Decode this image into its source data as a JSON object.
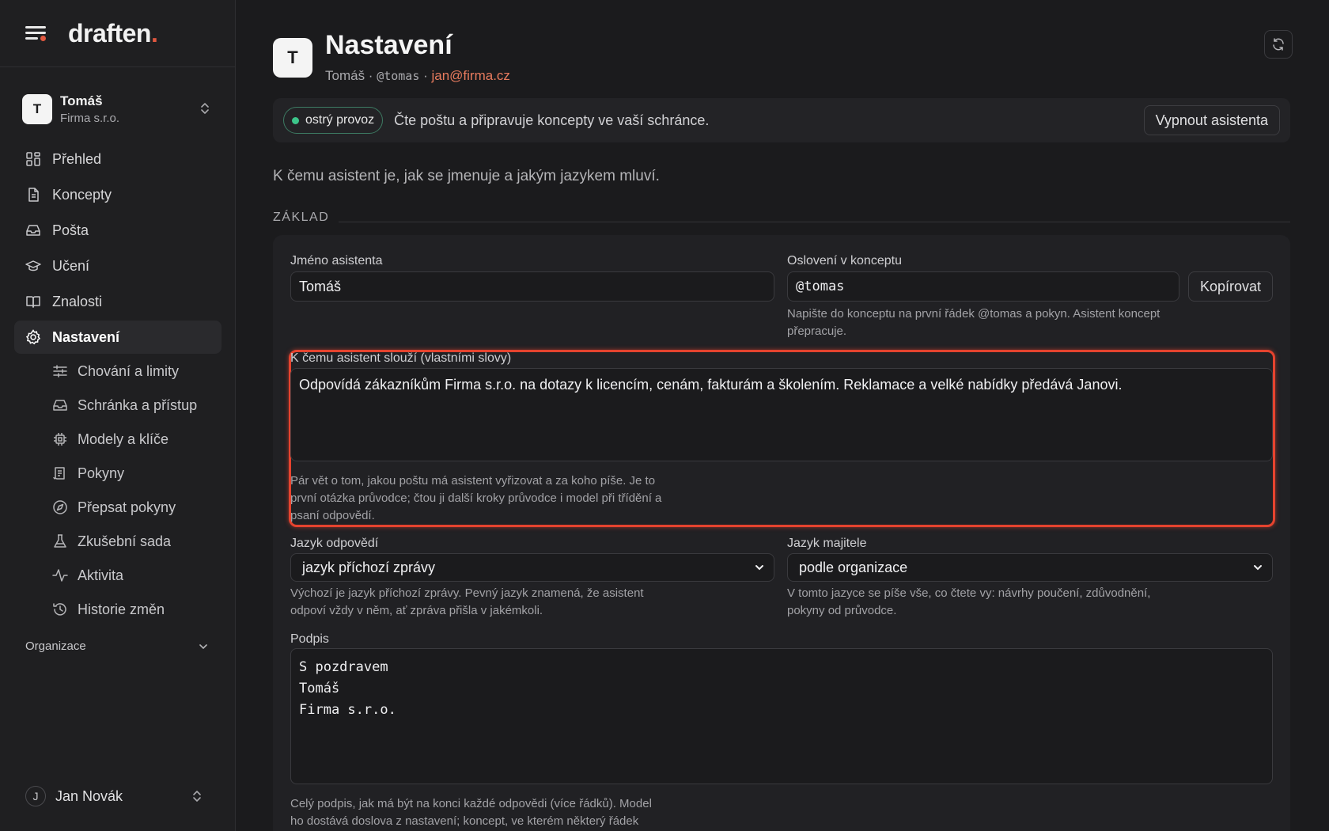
{
  "brand": {
    "name": "draften",
    "accent_dot": "."
  },
  "account": {
    "initial": "T",
    "name": "Tomáš",
    "org": "Firma s.r.o."
  },
  "nav": [
    {
      "label": "Přehled",
      "icon": "grid-icon"
    },
    {
      "label": "Koncepty",
      "icon": "document-icon"
    },
    {
      "label": "Pošta",
      "icon": "inbox-icon"
    },
    {
      "label": "Učení",
      "icon": "graduation-cap-icon"
    },
    {
      "label": "Znalosti",
      "icon": "book-icon"
    },
    {
      "label": "Nastavení",
      "icon": "gear-icon",
      "active": true
    }
  ],
  "subnav": [
    {
      "label": "Chování a limity",
      "icon": "sliders-icon"
    },
    {
      "label": "Schránka a přístup",
      "icon": "inbox-icon"
    },
    {
      "label": "Modely a klíče",
      "icon": "chip-icon"
    },
    {
      "label": "Pokyny",
      "icon": "scroll-icon"
    },
    {
      "label": "Přepsat pokyny",
      "icon": "compass-icon"
    },
    {
      "label": "Zkušební sada",
      "icon": "flask-icon"
    },
    {
      "label": "Aktivita",
      "icon": "activity-icon"
    },
    {
      "label": "Historie změn",
      "icon": "history-icon"
    }
  ],
  "org_section": {
    "label": "Organizace"
  },
  "user": {
    "initial": "J",
    "name": "Jan Novák"
  },
  "header": {
    "initial": "T",
    "title": "Nastavení",
    "name": "Tomáš",
    "sep1": " · ",
    "handle": "@tomas",
    "sep2": " · ",
    "email": "jan@firma.cz"
  },
  "status": {
    "badge": "ostrý provoz",
    "text": "Čte poštu a připravuje koncepty ve vaší schránce.",
    "off_button": "Vypnout asistenta"
  },
  "intro": "K čemu asistent je, jak se jmenuje a jakým jazykem mluví.",
  "section_label": "ZÁKLAD",
  "form": {
    "name_label": "Jméno asistenta",
    "name_value": "Tomáš",
    "address_label": "Oslovení v konceptu",
    "address_value": "@tomas",
    "copy_button": "Kopírovat",
    "address_help_1": "Napište do konceptu na první řádek @tomas a pokyn. Asistent koncept",
    "address_help_2": "přepracuje.",
    "purpose_label": "K čemu asistent slouží (vlastními slovy)",
    "purpose_value": "Odpovídá zákazníkům Firma s.r.o. na dotazy k licencím, cenám, fakturám a školením. Reklamace a velké nabídky předává Janovi.",
    "purpose_help_1": "Pár vět o tom, jakou poštu má asistent vyřizovat a za koho píše. Je to",
    "purpose_help_2": "první otázka průvodce; čtou ji další kroky průvodce i model při třídění a",
    "purpose_help_3": "psaní odpovědí.",
    "reply_lang_label": "Jazyk odpovědí",
    "reply_lang_value": "jazyk příchozí zprávy",
    "reply_lang_help_1": "Výchozí je jazyk příchozí zprávy. Pevný jazyk znamená, že asistent",
    "reply_lang_help_2": "odpoví vždy v něm, ať zpráva přišla v jakémkoli.",
    "owner_lang_label": "Jazyk majitele",
    "owner_lang_value": "podle organizace",
    "owner_lang_help_1": "V tomto jazyce se píše vše, co čtete vy: návrhy poučení, zdůvodnění,",
    "owner_lang_help_2": "pokyny od průvodce.",
    "signature_label": "Podpis",
    "signature_lines": [
      "S pozdravem",
      "Tomáš",
      "Firma s.r.o."
    ],
    "signature_help_1": "Celý podpis, jak má být na konci každé odpovědi (více řádků). Model",
    "signature_help_2": "ho dostává doslova z nastavení; koncept, ve kterém některý řádek"
  },
  "colors": {
    "accent": "#e0573f",
    "highlight": "#e5432e",
    "live_dot": "#3cc58a",
    "email": "#e87b5e"
  }
}
